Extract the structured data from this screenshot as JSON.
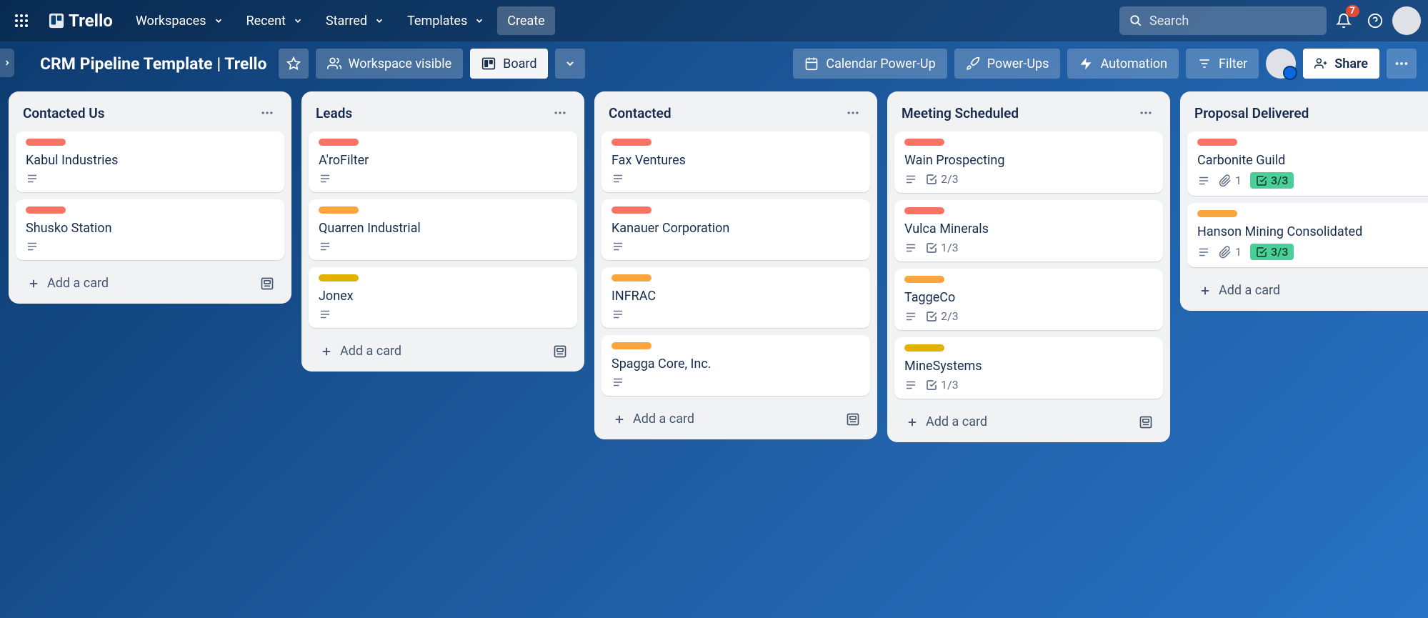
{
  "nav": {
    "logo": "Trello",
    "workspaces": "Workspaces",
    "recent": "Recent",
    "starred": "Starred",
    "templates": "Templates",
    "create": "Create",
    "search_placeholder": "Search",
    "notification_count": "7"
  },
  "board": {
    "title": "CRM Pipeline Template | Trello",
    "workspace_visible": "Workspace visible",
    "board_btn": "Board",
    "calendar": "Calendar Power-Up",
    "powerups": "Power-Ups",
    "automation": "Automation",
    "filter": "Filter",
    "share": "Share"
  },
  "ui": {
    "add_card": "Add a card"
  },
  "lists": [
    {
      "title": "Contacted Us",
      "cards": [
        {
          "label": "red",
          "title": "Kabul Industries",
          "badges": {
            "desc": true
          }
        },
        {
          "label": "red",
          "title": "Shusko Station",
          "badges": {
            "desc": true
          }
        }
      ]
    },
    {
      "title": "Leads",
      "cards": [
        {
          "label": "red",
          "title": "A'roFilter",
          "badges": {
            "desc": true
          }
        },
        {
          "label": "orange",
          "title": "Quarren Industrial",
          "badges": {
            "desc": true
          }
        },
        {
          "label": "yellow",
          "title": "Jonex",
          "badges": {
            "desc": true
          }
        }
      ]
    },
    {
      "title": "Contacted",
      "cards": [
        {
          "label": "red",
          "title": "Fax Ventures",
          "badges": {
            "desc": true
          }
        },
        {
          "label": "red",
          "title": "Kanauer Corporation",
          "badges": {
            "desc": true
          }
        },
        {
          "label": "orange",
          "title": "INFRAC",
          "badges": {
            "desc": true
          }
        },
        {
          "label": "orange",
          "title": "Spagga Core, Inc.",
          "badges": {
            "desc": true
          }
        }
      ]
    },
    {
      "title": "Meeting Scheduled",
      "cards": [
        {
          "label": "red",
          "title": "Wain Prospecting",
          "badges": {
            "desc": true,
            "checklist": "2/3"
          }
        },
        {
          "label": "red",
          "title": "Vulca Minerals",
          "badges": {
            "desc": true,
            "checklist": "1/3"
          }
        },
        {
          "label": "orange",
          "title": "TaggeCo",
          "badges": {
            "desc": true,
            "checklist": "2/3"
          }
        },
        {
          "label": "yellow",
          "title": "MineSystems",
          "badges": {
            "desc": true,
            "checklist": "1/3"
          }
        }
      ]
    },
    {
      "title": "Proposal Delivered",
      "cards": [
        {
          "label": "red",
          "title": "Carbonite Guild",
          "badges": {
            "desc": true,
            "attach": "1",
            "checklist": "3/3",
            "check_done": true
          }
        },
        {
          "label": "orange",
          "title": "Hanson Mining Consolidated",
          "badges": {
            "desc": true,
            "attach": "1",
            "checklist": "3/3",
            "check_done": true
          }
        }
      ]
    }
  ]
}
